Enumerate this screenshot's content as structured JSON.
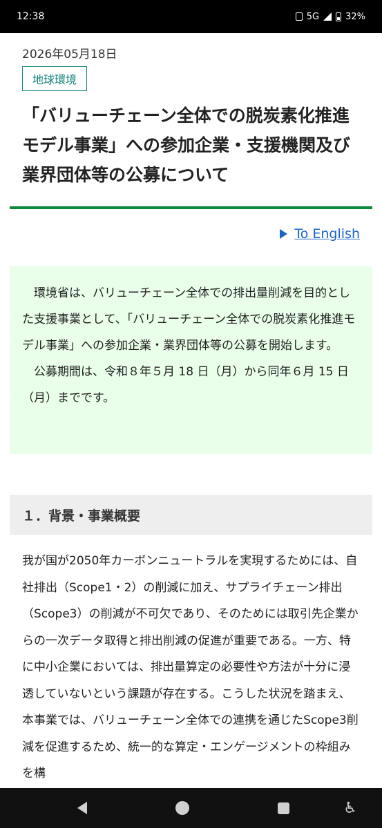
{
  "status": {
    "time": "12:38",
    "network": "5G",
    "battery": "32%"
  },
  "article": {
    "date": "2026年05月18日",
    "tag": "地球環境",
    "title": "「バリューチェーン全体での脱炭素化推進モデル事業」への参加企業・支援機関及び業界団体等の公募について",
    "lang_link": "To English"
  },
  "notice": {
    "paragraph1": "環境省は、バリューチェーン全体での排出量削減を目的とした支援事業として、「バリューチェーン全体での脱炭素化推進モデル事業」への参加企業・業界団体等の公募を開始します。",
    "paragraph2": "公募期間は、令和８年５月 18 日（月）から同年６月 15 日（月）までです。"
  },
  "section": {
    "heading": "１．背景・事業概要",
    "body": "我が国が2050年カーボンニュートラルを実現するためには、自社排出（Scope1・2）の削減に加え、サプライチェーン排出（Scope3）の削減が不可欠であり、そのためには取引先企業からの一次データ取得と排出削減の促進が重要である。一方、特に中小企業においては、排出量算定の必要性や方法が十分に浸透していないという課題が存在する。こうした状況を踏まえ、本事業では、バリューチェーン全体での連携を通じたScope3削減を促進するため、統一的な算定・エンゲージメントの枠組みを構"
  },
  "icons": {
    "vibrate": "vibrate-icon",
    "signal": "signal-icon",
    "battery": "battery-icon",
    "back": "back-icon",
    "home": "home-icon",
    "recents": "recents-icon",
    "accessibility": "accessibility-icon"
  },
  "colors": {
    "accent": "#12837a",
    "rule": "#0f8a3c",
    "link": "#1a64c8",
    "notice_bg": "#e9ffe9"
  }
}
